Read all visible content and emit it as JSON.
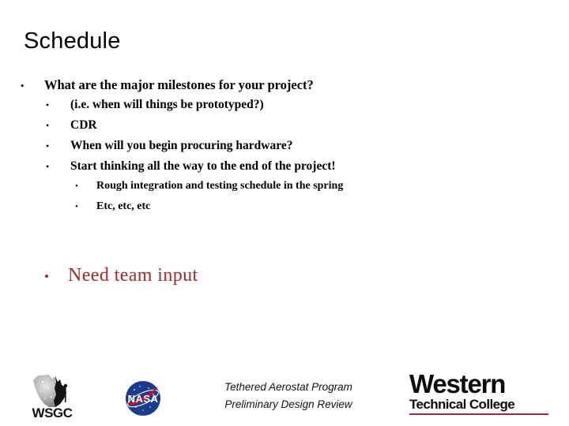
{
  "slide": {
    "title": "Schedule",
    "bullets": [
      {
        "level": 1,
        "marker": "•",
        "text": "What are the major milestones for your project?"
      },
      {
        "level": 2,
        "marker": "•",
        "text": "(i.e. when will things be prototyped?)"
      },
      {
        "level": 2,
        "marker": "•",
        "text": "CDR"
      },
      {
        "level": 2,
        "marker": "•",
        "text": "When will you begin procuring hardware?"
      },
      {
        "level": 2,
        "marker": "•",
        "text": "Start thinking all the way to the end of the project!"
      },
      {
        "level": 3,
        "marker": "•",
        "text": "Rough integration and testing schedule in the spring"
      },
      {
        "level": 3,
        "marker": "•",
        "text": "Etc, etc, etc"
      }
    ],
    "highlight": {
      "marker": "•",
      "text": "Need team input",
      "color": "#A32A2A"
    }
  },
  "footer": {
    "caption_line1": "Tethered Aerostat Program",
    "caption_line2": "Preliminary Design Review",
    "logos": {
      "wsgc": {
        "name": "wsgc-logo",
        "wordmark": "WSGC",
        "state_light": "#b9b9b9",
        "state_dark": "#161616"
      },
      "nasa": {
        "name": "nasa-insignia-logo",
        "wordmark": "NASA",
        "circle_color": "#1B3C8C",
        "swoosh_color": "#C8102E",
        "text_color": "#FFFFFF"
      },
      "western": {
        "name": "western-technical-college-logo",
        "line1": "Western",
        "line2": "Technical College",
        "rule_color": "#9C2A46",
        "text_color": "#0C0C0C"
      }
    }
  }
}
